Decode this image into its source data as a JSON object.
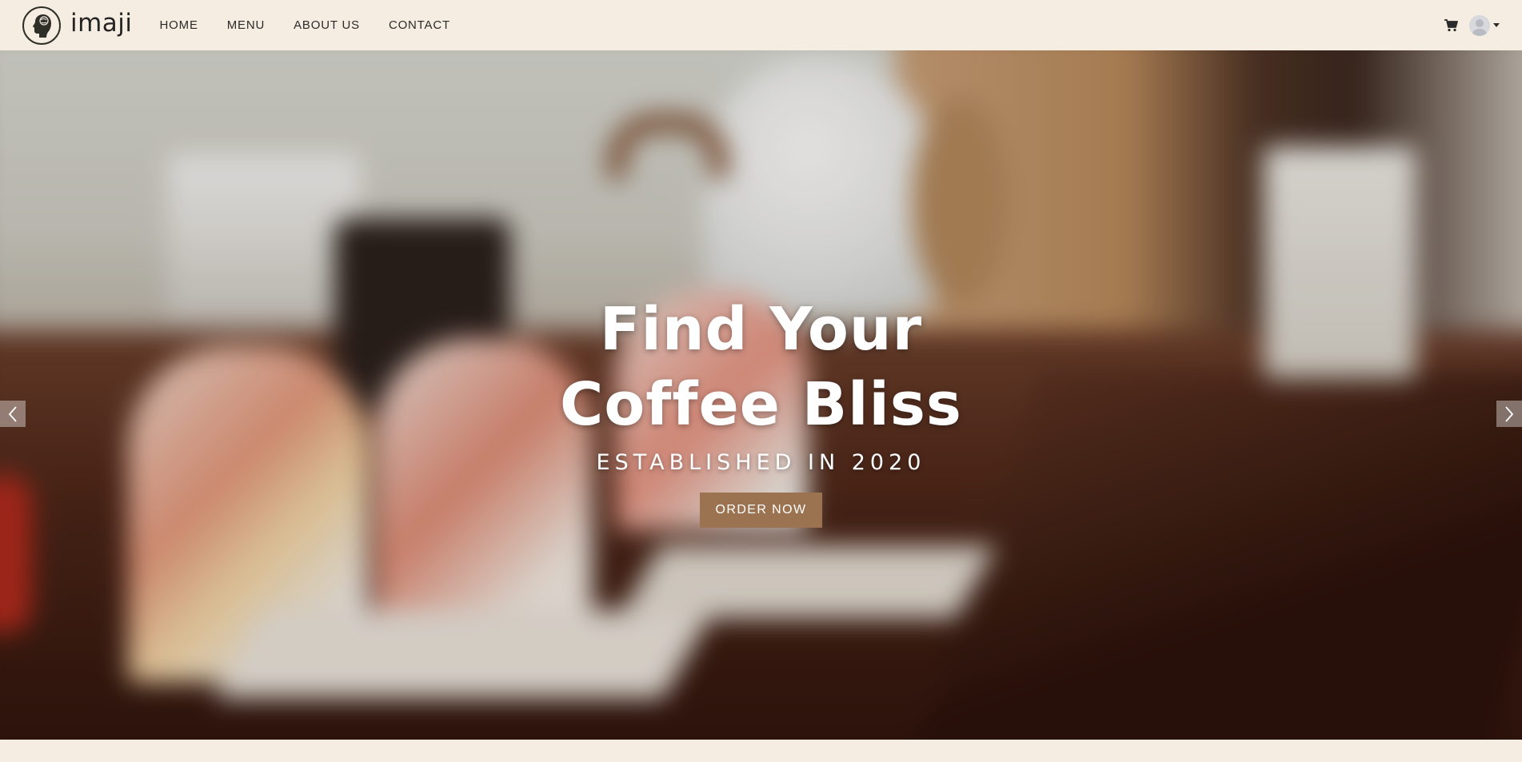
{
  "brand": {
    "name": "imaji",
    "logo_icon": "head-silhouette-icon"
  },
  "nav": {
    "links": [
      {
        "label": "HOME"
      },
      {
        "label": "MENU"
      },
      {
        "label": "ABOUT US"
      },
      {
        "label": "CONTACT"
      }
    ],
    "cart_icon": "shopping-cart-icon",
    "user_icon": "user-avatar-icon"
  },
  "hero": {
    "title_line1": "Find Your",
    "title_line2": "Coffee Bliss",
    "subtitle": "ESTABLISHED IN 2020",
    "cta_label": "ORDER NOW",
    "prev_icon": "chevron-left-icon",
    "next_icon": "chevron-right-icon"
  },
  "colors": {
    "background": "#f5ede1",
    "accent": "#9b7350",
    "text_dark": "#2a2a2a"
  }
}
